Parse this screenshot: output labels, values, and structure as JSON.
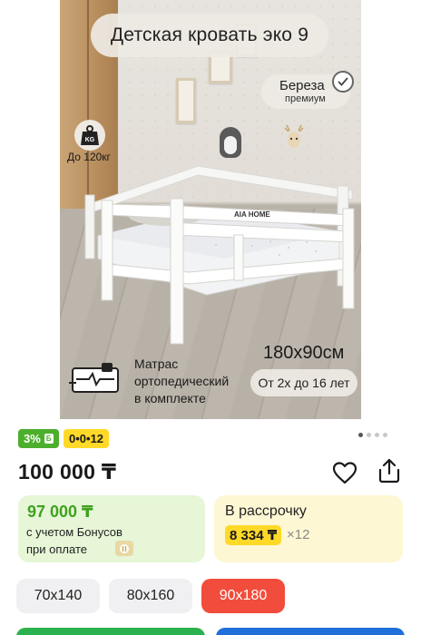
{
  "product_photo": {
    "title": "Детская кровать эко 9",
    "wood_type": "Береза",
    "wood_grade": "премиум",
    "weight_icon_text": "KG",
    "weight_limit": "До 120кг",
    "brand_mark": "AIA HOME",
    "mattress_info": [
      "Матрас",
      "ортопедический",
      "в комплекте"
    ],
    "dimensions": "180х90см",
    "age_range": "От 2х до 16 лет",
    "pager": {
      "total": 4,
      "current": 1
    }
  },
  "badges": {
    "bonus": "3%",
    "bonus_icon": "Б",
    "installment": "0•0•12"
  },
  "price": {
    "main": "100 000 ₸"
  },
  "bonus_card": {
    "price": "97 000 ₸",
    "line1": "с учетом Бонусов",
    "line2": "при оплате"
  },
  "installment_card": {
    "label": "В рассрочку",
    "monthly": "8 334 ₸",
    "multiplier": "×12"
  },
  "sizes": {
    "options": [
      "70х140",
      "80х160",
      "90х180"
    ],
    "selected": "90х180"
  },
  "colors": {
    "green": "#4caf2c",
    "yellow": "#ffd928",
    "red": "#f24d3c",
    "blue": "#1e6fd9"
  }
}
